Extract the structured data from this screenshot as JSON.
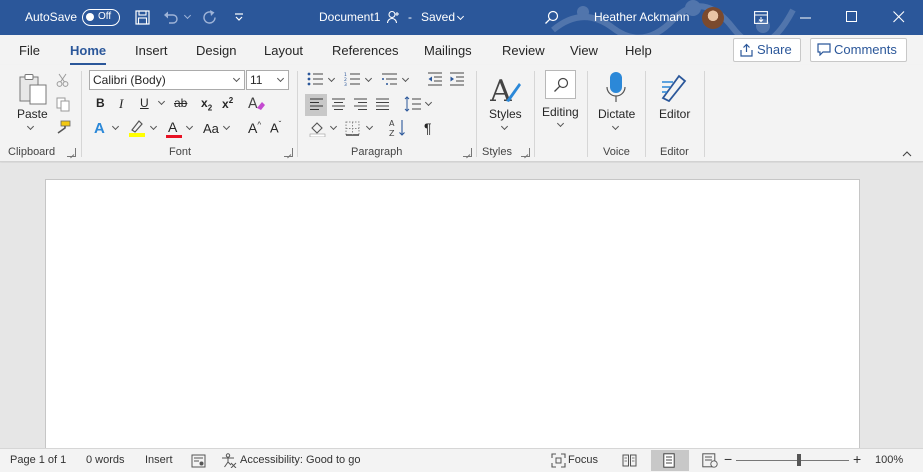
{
  "titlebar": {
    "autosave_label": "AutoSave",
    "autosave_state": "Off",
    "document_name": "Document1",
    "saved_status": "Saved",
    "user_name": "Heather Ackmann"
  },
  "tabs": [
    {
      "label": "File"
    },
    {
      "label": "Home"
    },
    {
      "label": "Insert"
    },
    {
      "label": "Design"
    },
    {
      "label": "Layout"
    },
    {
      "label": "References"
    },
    {
      "label": "Mailings"
    },
    {
      "label": "Review"
    },
    {
      "label": "View"
    },
    {
      "label": "Help"
    }
  ],
  "share_label": "Share",
  "comments_label": "Comments",
  "ribbon": {
    "clipboard": {
      "paste_label": "Paste",
      "group_label": "Clipboard"
    },
    "font": {
      "font_name": "Calibri (Body)",
      "font_size": "11",
      "bold": "B",
      "italic": "I",
      "underline": "U",
      "strikethrough": "ab",
      "subscript": "x",
      "subscript_mark": "2",
      "superscript": "x",
      "superscript_mark": "2",
      "text_effects": "A",
      "font_color": "A",
      "change_case": "Aa",
      "grow_font": "A",
      "shrink_font": "A",
      "group_label": "Font"
    },
    "paragraph": {
      "group_label": "Paragraph"
    },
    "styles": {
      "styles_label": "Styles",
      "group_label": "Styles"
    },
    "editing": {
      "editing_label": "Editing"
    },
    "voice": {
      "dictate_label": "Dictate",
      "group_label": "Voice"
    },
    "editor": {
      "editor_label": "Editor",
      "group_label": "Editor"
    }
  },
  "status": {
    "page": "Page 1 of 1",
    "words": "0 words",
    "mode": "Insert",
    "accessibility": "Accessibility: Good to go",
    "focus": "Focus",
    "zoom_out": "−",
    "zoom_in": "+",
    "zoom": "100%"
  },
  "colors": {
    "brand": "#2b579a",
    "highlight_yellow": "#ffff00",
    "font_color_red": "#e81123",
    "text_effects_blue": "#2b88d8"
  }
}
